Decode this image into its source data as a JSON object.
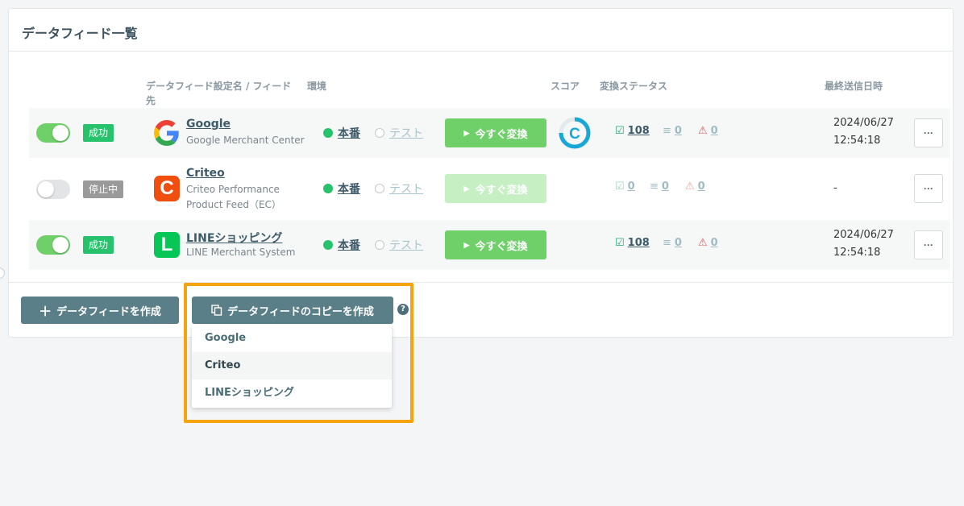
{
  "panel": {
    "title": "データフィード一覧"
  },
  "table": {
    "headers": {
      "name": "データフィード設定名 / フィード先",
      "env": "環境",
      "score": "スコア",
      "status": "変換ステータス",
      "last_sent": "最終送信日時"
    }
  },
  "rows": [
    {
      "toggle": "on",
      "badge": "成功",
      "logo": "google-logo",
      "name": "Google",
      "sub": "Google Merchant Center",
      "env_prod": "本番",
      "env_test": "テスト",
      "convert": "今すぐ変換",
      "score": "C",
      "stat_ok": "108",
      "stat_x": "0",
      "stat_warn": "0",
      "last_sent_date": "2024/06/27",
      "last_sent_time": "12:54:18",
      "more": "···"
    },
    {
      "toggle": "off",
      "badge": "停止中",
      "logo_letter": "C",
      "name": "Criteo",
      "sub": "Criteo Performance Product Feed（EC）",
      "env_prod": "本番",
      "env_test": "テスト",
      "convert": "今すぐ変換",
      "stat_ok": "0",
      "stat_x": "0",
      "stat_warn": "0",
      "last_sent": "-",
      "more": "···"
    },
    {
      "toggle": "on",
      "badge": "成功",
      "logo_letter": "L",
      "name": "LINEショッピング",
      "sub": "LINE Merchant System",
      "env_prod": "本番",
      "env_test": "テスト",
      "convert": "今すぐ変換",
      "stat_ok": "108",
      "stat_x": "0",
      "stat_warn": "0",
      "last_sent_date": "2024/06/27",
      "last_sent_time": "12:54:18",
      "more": "···"
    }
  ],
  "footer": {
    "create_label": "データフィードを作成",
    "copy_label": "データフィードのコピーを作成",
    "help": "?"
  },
  "dropdown": {
    "items": [
      "Google",
      "Criteo",
      "LINEショッピング"
    ]
  },
  "colors": {
    "accent_green": "#6fd06a",
    "success_badge": "#27c26c",
    "dark_button": "#5a7f88",
    "highlight": "#f5a30f"
  }
}
